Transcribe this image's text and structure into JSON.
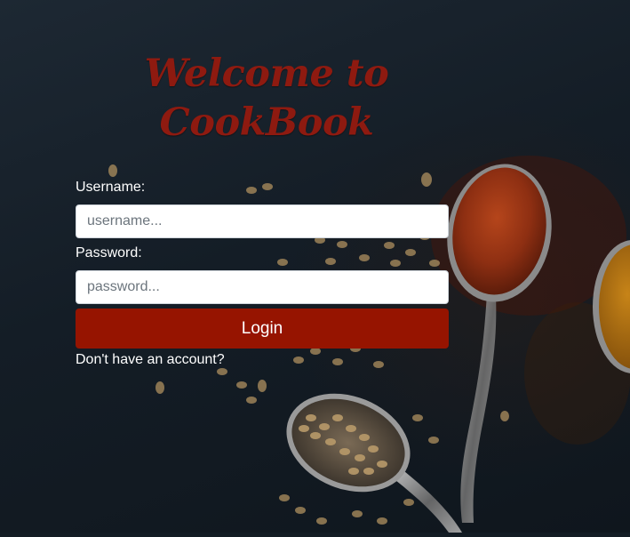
{
  "page": {
    "title_line1": "Welcome to",
    "title_line2": "CookBook"
  },
  "form": {
    "username_label": "Username:",
    "username_placeholder": "username...",
    "username_value": "",
    "password_label": "Password:",
    "password_placeholder": "password...",
    "password_value": "",
    "login_label": "Login",
    "signup_prompt": "Don't have an account?"
  },
  "colors": {
    "title": "#8e1a10",
    "button": "#961400",
    "label_text": "#ffffff",
    "background": "#131c24"
  }
}
